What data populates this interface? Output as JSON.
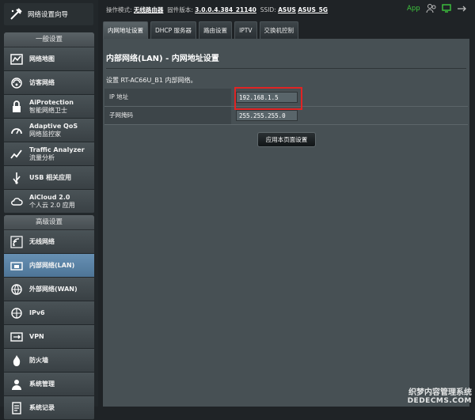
{
  "topbar": {
    "mode_label": "操作模式:",
    "mode_value": "无线路由器",
    "fw_label": "固件版本:",
    "fw_value": "3.0.0.4.384_21140",
    "ssid_label": "SSID:",
    "ssid_1": "ASUS",
    "ssid_2": "ASUS_5G",
    "app_label": "App"
  },
  "sidebar": {
    "wizard_label": "网络设置向导",
    "general_header": "一般设置",
    "general_items": [
      {
        "line1": "网络地图",
        "line2": ""
      },
      {
        "line1": "访客网络",
        "line2": ""
      },
      {
        "line1": "AiProtection",
        "line2": "智能网络卫士"
      },
      {
        "line1": "Adaptive QoS",
        "line2": "网络监控家"
      },
      {
        "line1": "Traffic Analyzer",
        "line2": "流量分析"
      },
      {
        "line1": "USB 相关应用",
        "line2": ""
      },
      {
        "line1": "AiCloud 2.0",
        "line2": "个人云 2.0 应用"
      }
    ],
    "advanced_header": "高级设置",
    "advanced_items": [
      {
        "line1": "无线网络"
      },
      {
        "line1": "内部网络(LAN)"
      },
      {
        "line1": "外部网络(WAN)"
      },
      {
        "line1": "IPv6"
      },
      {
        "line1": "VPN"
      },
      {
        "line1": "防火墙"
      },
      {
        "line1": "系统管理"
      },
      {
        "line1": "系统记录"
      }
    ]
  },
  "tabs": [
    "内网地址设置",
    "DHCP 服务器",
    "路由设置",
    "IPTV",
    "交换机控制"
  ],
  "main": {
    "title": "内部网络(LAN) - 内网地址设置",
    "description": "设置 RT-AC66U_B1 内部网络。",
    "ip_label": "IP 地址",
    "ip_value": "192.168.1.5",
    "mask_label": "子网掩码",
    "mask_value": "255.255.255.0",
    "apply_label": "应用本页面设置"
  },
  "watermark": {
    "line1": "织梦内容管理系统",
    "line2": "DEDECMS.COM"
  },
  "colors": {
    "accent_active": "#5a84a8",
    "highlight": "#e02424",
    "app_green": "#3ec63e"
  }
}
